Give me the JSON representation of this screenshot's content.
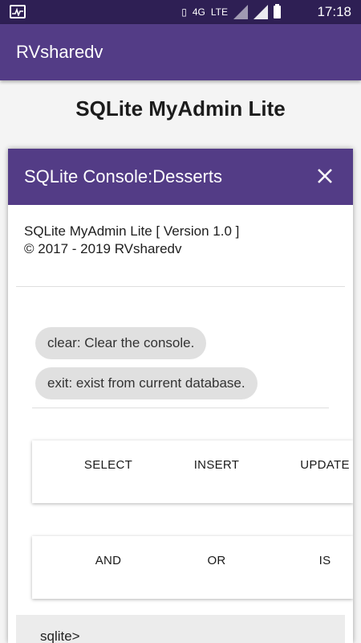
{
  "status_bar": {
    "time": "17:18",
    "network_label": "4G",
    "lte_label": "LTE",
    "icons": [
      "activity-icon",
      "vibrate-icon",
      "4g-icon",
      "lte-icon",
      "signal-icon",
      "signal-icon",
      "battery-icon"
    ]
  },
  "app_bar": {
    "title": "RVsharedv"
  },
  "page": {
    "title": "SQLite MyAdmin Lite"
  },
  "dialog": {
    "title": "SQLite Console:Desserts",
    "close_icon": "close-icon",
    "version_line1": "SQLite MyAdmin Lite [ Version 1.0 ]",
    "version_line2": "© 2017 - 2019 RVsharedv",
    "help_chips": [
      "clear: Clear the console.",
      "exit: exist from current database."
    ],
    "keyword_rows": [
      [
        "SELECT",
        "INSERT",
        "UPDATE"
      ],
      [
        "AND",
        "OR",
        "IS"
      ]
    ],
    "prompt": "sqlite>"
  },
  "colors": {
    "status_bar": "#2e1f54",
    "primary": "#533c86",
    "chip": "#e0e0e0"
  }
}
